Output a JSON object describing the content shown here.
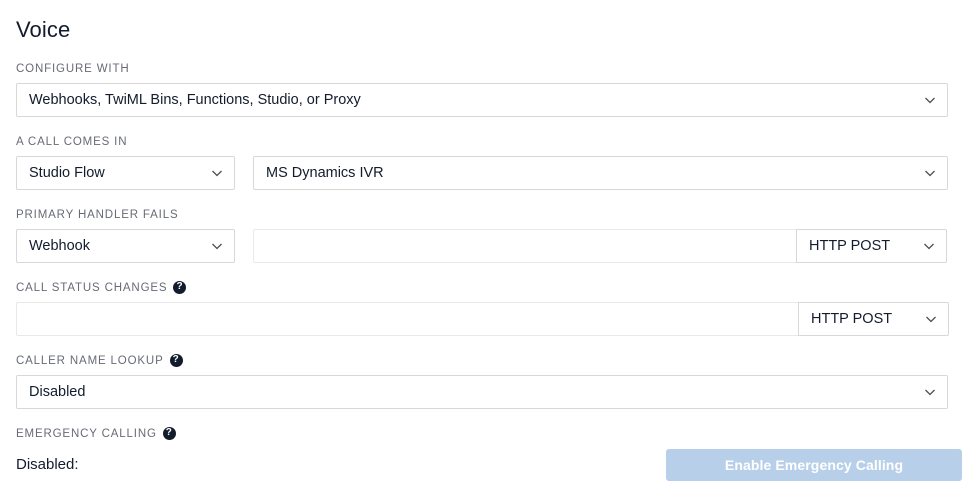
{
  "page": {
    "title": "Voice"
  },
  "configure_with": {
    "label": "CONFIGURE WITH",
    "value": "Webhooks, TwiML Bins, Functions, Studio, or Proxy",
    "icon": "chevron-down-icon"
  },
  "a_call_comes_in": {
    "label": "A CALL COMES IN",
    "handler_type": "Studio Flow",
    "target": "MS Dynamics IVR"
  },
  "primary_handler_fails": {
    "label": "PRIMARY HANDLER FAILS",
    "handler_type": "Webhook",
    "url": "",
    "url_placeholder": "",
    "method": "HTTP POST"
  },
  "call_status_changes": {
    "label": "CALL STATUS CHANGES",
    "help_icon": "question-mark-icon",
    "help_glyph": "?",
    "url": "",
    "url_placeholder": "",
    "method": "HTTP POST"
  },
  "caller_name_lookup": {
    "label": "CALLER NAME LOOKUP",
    "help_icon": "question-mark-icon",
    "help_glyph": "?",
    "value": "Disabled"
  },
  "emergency_calling": {
    "label": "EMERGENCY CALLING",
    "help_icon": "question-mark-icon",
    "help_glyph": "?",
    "status": "Disabled:",
    "button_label": "Enable Emergency Calling",
    "button_color": "#b7cfe8"
  },
  "colors": {
    "text": "#121c2d",
    "label": "#686b75",
    "border": "#d8d8d8",
    "border_light": "#e9e9e9",
    "button_disabled": "#b7cfe8"
  }
}
